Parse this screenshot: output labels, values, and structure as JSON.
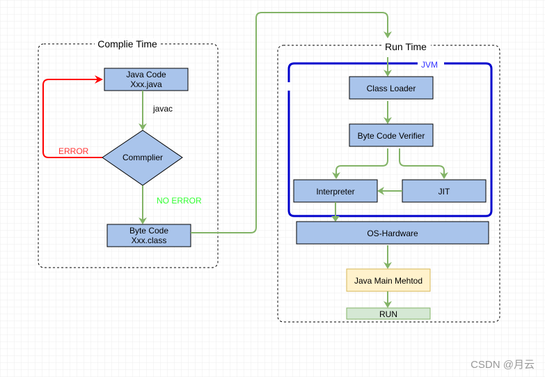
{
  "compile_time": {
    "title": "Complie Time",
    "java_code": {
      "line1": "Java Code",
      "line2": "Xxx.java"
    },
    "javac_label": "javac",
    "compiler": "Commplier",
    "error_label": "ERROR",
    "no_error_label": "NO ERROR",
    "byte_code": {
      "line1": "Byte Code",
      "line2": "Xxx.class"
    }
  },
  "run_time": {
    "title": "Run Time",
    "jvm_label": "JVM",
    "class_loader": "Class Loader",
    "verifier": "Byte Code Verifier",
    "interpreter": "Interpreter",
    "jit": "JIT",
    "os_hardware": "OS-Hardware",
    "main_method": "Java Main Mehtod",
    "run": "RUN"
  },
  "watermark": "CSDN @月云",
  "colors": {
    "box_fill": "#a9c4eb",
    "arrow": "#82b366",
    "error": "#ff0000",
    "no_error": "#33ff33",
    "jvm": "#0000cc",
    "main_fill": "#fff2cc",
    "run_fill": "#d5e8d4"
  }
}
